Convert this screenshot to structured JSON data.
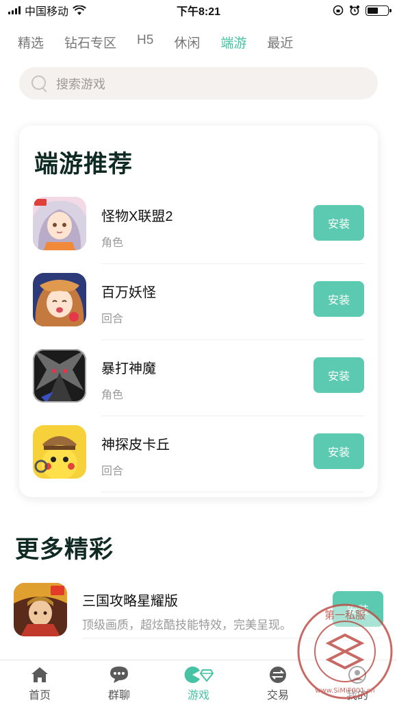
{
  "status_bar": {
    "carrier": "中国移动",
    "time": "下午8:21"
  },
  "tabs": [
    {
      "label": "精选",
      "active": false
    },
    {
      "label": "钻石专区",
      "active": false
    },
    {
      "label": "H5",
      "active": false
    },
    {
      "label": "休闲",
      "active": false
    },
    {
      "label": "端游",
      "active": true
    },
    {
      "label": "最近",
      "active": false
    }
  ],
  "search": {
    "placeholder": "搜索游戏"
  },
  "recommend": {
    "title": "端游推荐",
    "games": [
      {
        "name": "怪物X联盟2",
        "tag": "角色",
        "button": "安装",
        "icon": "anime-girl-silver-hair-icon"
      },
      {
        "name": "百万妖怪",
        "tag": "回合",
        "button": "安装",
        "icon": "anime-girl-brown-hair-icon"
      },
      {
        "name": "暴打神魔",
        "tag": "角色",
        "button": "安装",
        "icon": "dark-dragon-icon"
      },
      {
        "name": "神探皮卡丘",
        "tag": "回合",
        "button": "安装",
        "icon": "detective-pikachu-icon"
      }
    ]
  },
  "more": {
    "title": "更多精彩",
    "games": [
      {
        "name": "三国攻略星耀版",
        "desc": "顶级画质，超炫酷技能特效，完美呈现。",
        "button": "安装",
        "icon": "three-kingdoms-warrior-icon"
      }
    ]
  },
  "bottom_nav": [
    {
      "label": "首页",
      "icon": "home-icon",
      "active": false
    },
    {
      "label": "群聊",
      "icon": "chat-icon",
      "active": false
    },
    {
      "label": "游戏",
      "icon": "game-icon",
      "active": true
    },
    {
      "label": "交易",
      "icon": "exchange-icon",
      "active": false
    },
    {
      "label": "我的",
      "icon": "profile-icon",
      "active": false
    }
  ],
  "watermark": {
    "text_top": "第一私服",
    "text_bottom": "www.SiMiF001.cn"
  },
  "colors": {
    "accent": "#46c3a4",
    "button": "#5ccab0",
    "title": "#0f2a22"
  }
}
